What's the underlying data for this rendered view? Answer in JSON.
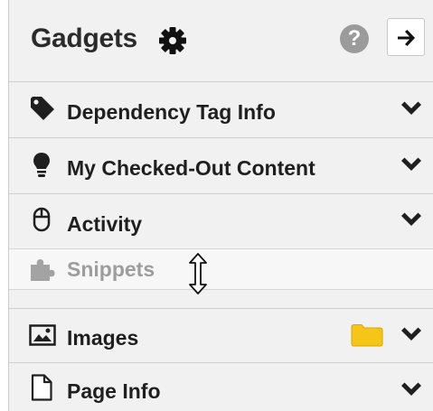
{
  "header": {
    "title": "Gadgets",
    "help_symbol": "?",
    "settings_icon": "gear-icon",
    "collapse_icon": "arrow-right-icon"
  },
  "gadgets": [
    {
      "label": "Dependency Tag Info",
      "icon": "tag-icon"
    },
    {
      "label": "My Checked-Out Content",
      "icon": "lightbulb-icon"
    },
    {
      "label": "Activity",
      "icon": "mouse-icon"
    },
    {
      "label": "Snippets",
      "icon": "puzzle-icon",
      "state": "dragging"
    },
    {
      "label": "Images",
      "icon": "image-icon",
      "extra_icon": "folder-icon"
    },
    {
      "label": "Page Info",
      "icon": "page-icon"
    }
  ],
  "colors": {
    "panel_bg": "#f1f1f1",
    "text": "#1f1f1f",
    "dragging_text": "#9d9d9d",
    "folder": "#f5c518",
    "help_bg": "#9b9b9b"
  }
}
